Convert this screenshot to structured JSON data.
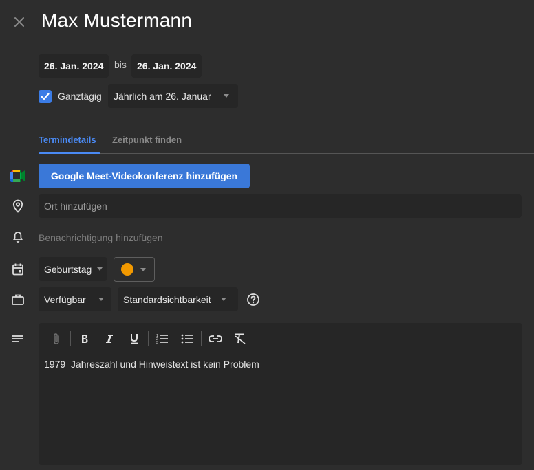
{
  "title": "Max Mustermann",
  "start_date": "26. Jan. 2024",
  "between_label": "bis",
  "end_date": "26. Jan. 2024",
  "all_day": {
    "label": "Ganztägig",
    "checked": true
  },
  "recurrence": {
    "selected": "Jährlich am 26. Januar"
  },
  "tabs": [
    {
      "label": "Termindetails",
      "active": true
    },
    {
      "label": "Zeitpunkt finden",
      "active": false
    }
  ],
  "meet_button_label": "Google Meet-Videokonferenz hinzufügen",
  "location": {
    "placeholder": "Ort hinzufügen",
    "value": ""
  },
  "notification_label": "Benachrichtigung hinzufügen",
  "calendar": {
    "selected": "Geburtstag"
  },
  "event_color": "#f29900",
  "availability": {
    "selected": "Verfügbar"
  },
  "visibility": {
    "selected": "Standardsichtbarkeit"
  },
  "description": "1979  Jahreszahl und Hinweistext ist kein Problem",
  "colors": {
    "background": "#2d2d2d",
    "field": "#262626",
    "accent": "#4a8af4",
    "button": "#3a78d8"
  },
  "icons": {
    "close": "close-icon",
    "meet": "google-meet-icon",
    "location": "map-pin-icon",
    "notification": "bell-icon",
    "calendar": "calendar-icon",
    "availability": "briefcase-icon",
    "help": "help-circle-icon",
    "description": "notes-lines-icon",
    "toolbar": [
      "attachment-icon",
      "bold-icon",
      "italic-icon",
      "underline-icon",
      "numbered-list-icon",
      "bulleted-list-icon",
      "link-icon",
      "clear-format-icon"
    ]
  }
}
